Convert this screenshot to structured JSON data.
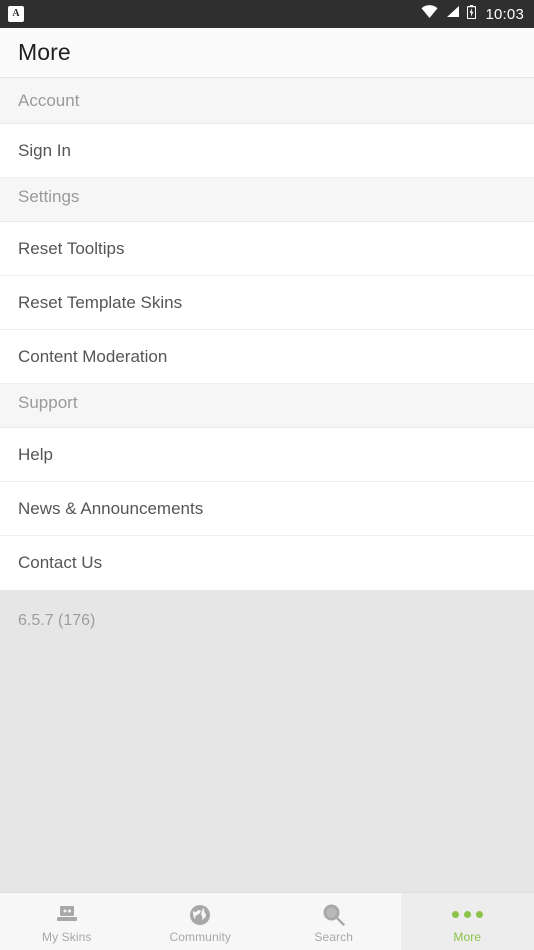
{
  "status_bar": {
    "notification_icon": "app-notification-icon",
    "notification_letter": "A",
    "wifi_icon": "wifi-icon",
    "signal_icon": "cellular-signal-icon",
    "battery_icon": "battery-icon",
    "time": "10:03",
    "background_color": "#2f2f2f",
    "foreground_color": "#ffffff"
  },
  "app_bar": {
    "title": "More"
  },
  "sections": [
    {
      "header": "Account",
      "items": [
        {
          "label": "Sign In"
        }
      ]
    },
    {
      "header": "Settings",
      "items": [
        {
          "label": "Reset Tooltips"
        },
        {
          "label": "Reset Template Skins"
        },
        {
          "label": "Content Moderation"
        }
      ]
    },
    {
      "header": "Support",
      "items": [
        {
          "label": "Help"
        },
        {
          "label": "News & Announcements"
        },
        {
          "label": "Contact Us"
        }
      ]
    }
  ],
  "footer": {
    "version": "6.5.7 (176)"
  },
  "bottom_nav": {
    "active_index": 3,
    "active_color": "#8bc34a",
    "inactive_color": "#a8a8a8",
    "tabs": [
      {
        "label": "My Skins",
        "icon": "laptop-icon"
      },
      {
        "label": "Community",
        "icon": "globe-icon"
      },
      {
        "label": "Search",
        "icon": "magnifier-icon"
      },
      {
        "label": "More",
        "icon": "three-dots-icon"
      }
    ]
  }
}
